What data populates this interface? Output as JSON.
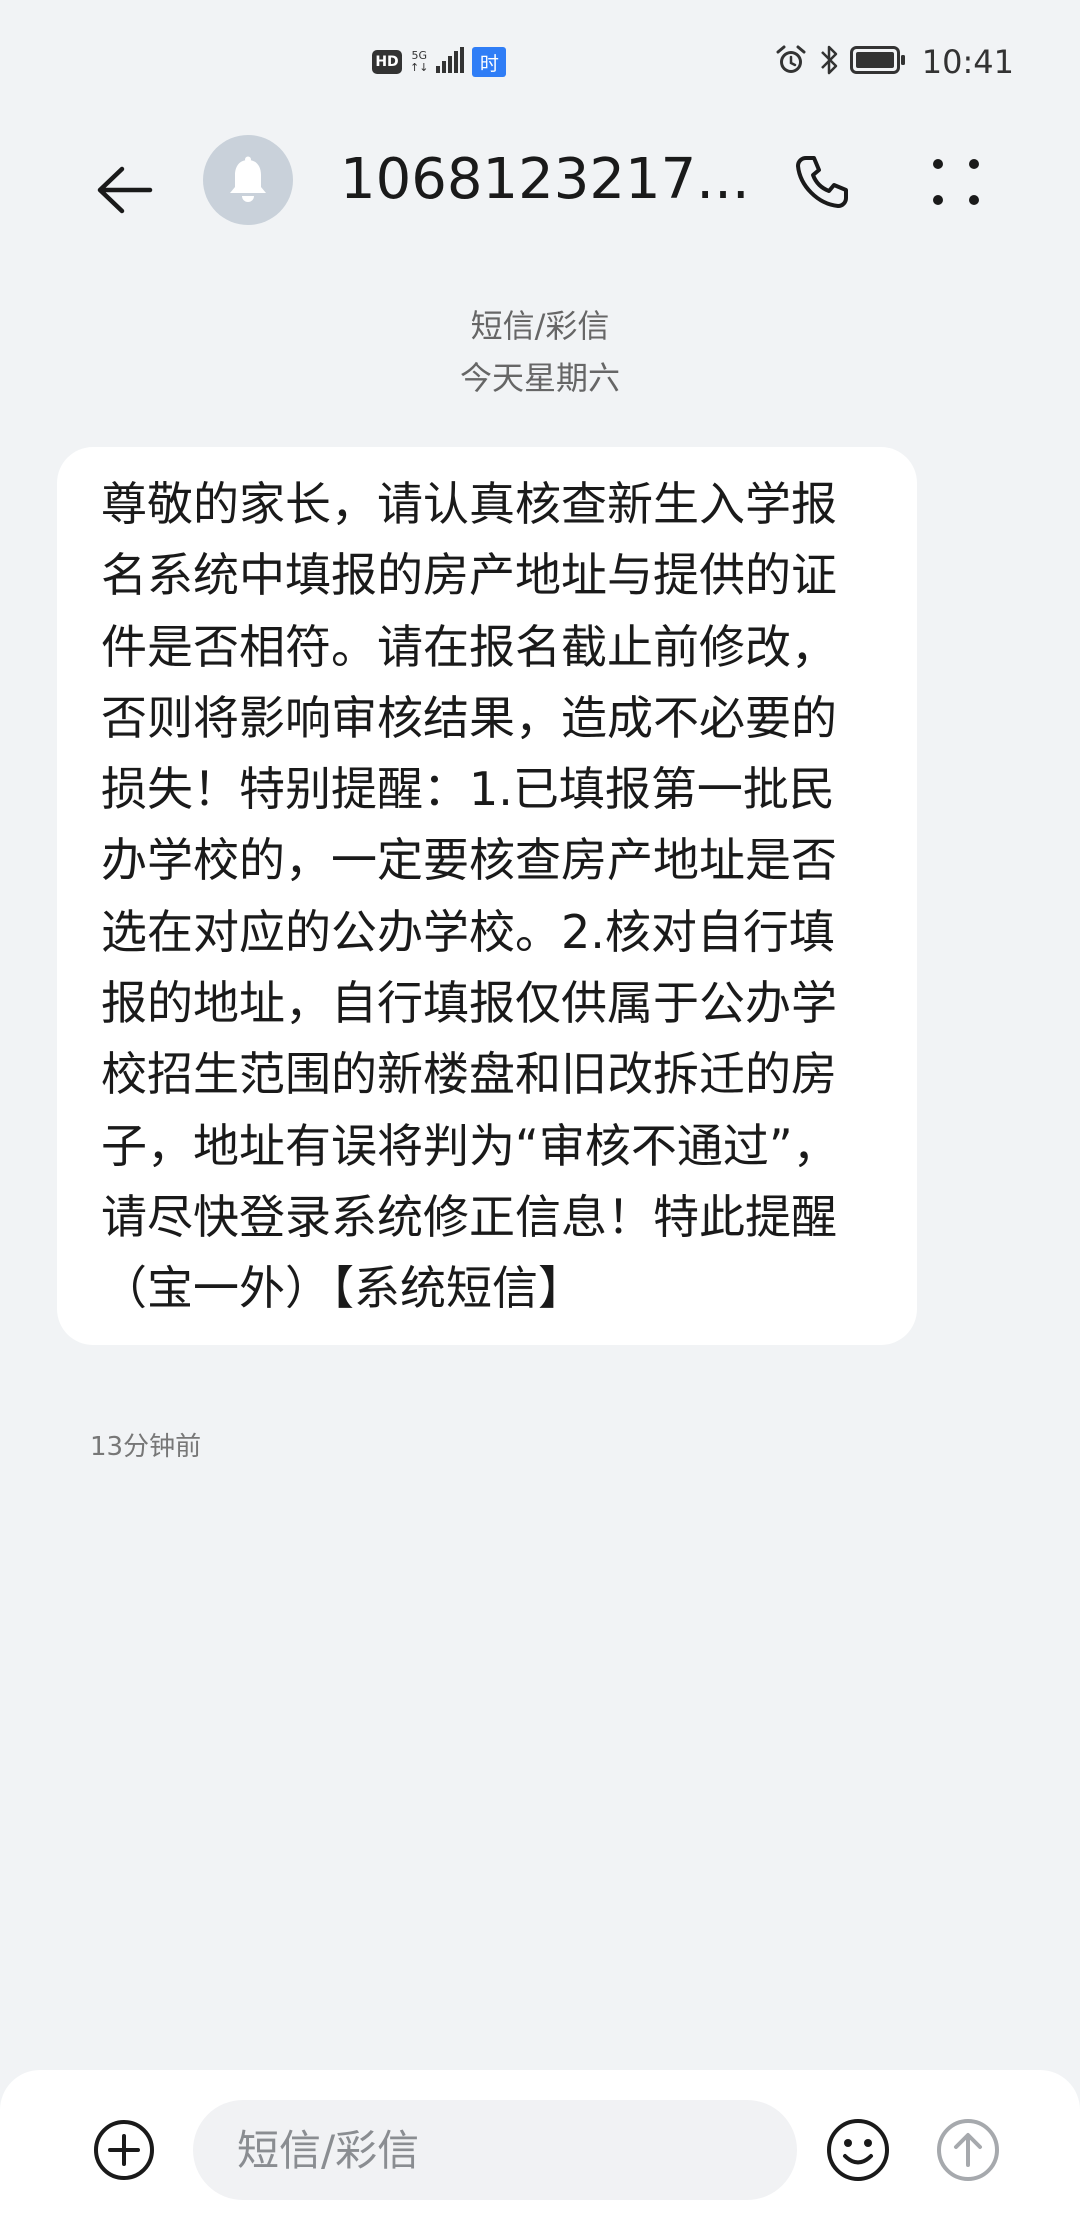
{
  "status_bar": {
    "hd": "HD",
    "network_top": "5G",
    "network_bottom": "↑↓",
    "time_badge": "时",
    "time": "10:41"
  },
  "header": {
    "contact": "1068123217..."
  },
  "conversation": {
    "type_label": "短信/彩信",
    "date_label": "今天星期六"
  },
  "message": {
    "text": "尊敬的家长，请认真核查新生入学报名系统中填报的房产地址与提供的证件是否相符。请在报名截止前修改，否则将影响审核结果，造成不必要的损失！特别提醒：1.已填报第一批民办学校的，一定要核查房产地址是否选在对应的公办学校。2.核对自行填报的地址，自行填报仅供属于公办学校招生范围的新楼盘和旧改拆迁的房子，地址有误将判为“审核不通过”，请尽快登录系统修正信息！特此提醒（宝一外）【系统短信】",
    "time": "13分钟前"
  },
  "input": {
    "placeholder": "短信/彩信",
    "value": ""
  },
  "colors": {
    "background": "#f1f3f5",
    "bubble": "#ffffff",
    "avatar": "#c9d1da",
    "badge_blue": "#2f7df6"
  },
  "icons": {
    "back": "arrow-left-icon",
    "avatar": "bell-icon",
    "call": "phone-icon",
    "more": "more-vertical-icon",
    "add": "plus-circle-icon",
    "emoji": "smiley-icon",
    "send": "arrow-up-circle-icon",
    "alarm": "alarm-icon",
    "bluetooth": "bluetooth-icon",
    "battery": "battery-icon",
    "signal": "signal-icon"
  }
}
